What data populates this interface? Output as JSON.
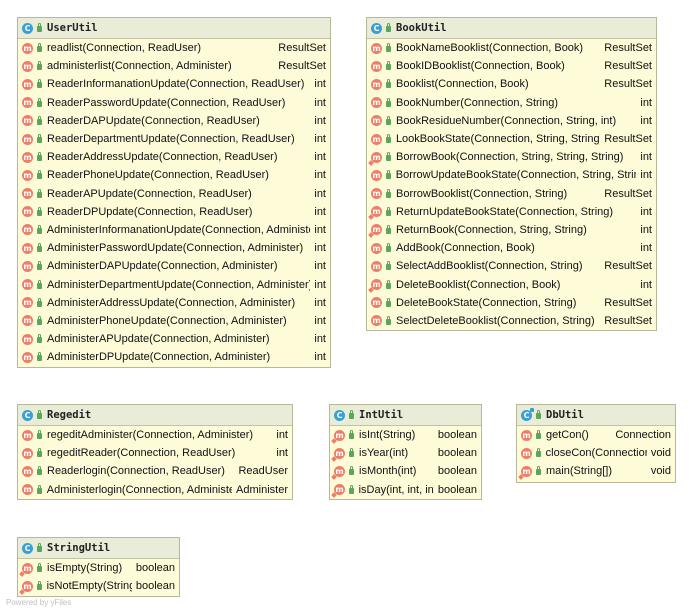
{
  "classes": [
    {
      "id": "userutil",
      "title": "UserUtil",
      "static_icon": false,
      "methods": [
        {
          "sig": "readlist(Connection, ReadUser)",
          "ret": "ResultSet",
          "static": false
        },
        {
          "sig": "administerlist(Connection, Administer)",
          "ret": "ResultSet",
          "static": false
        },
        {
          "sig": "ReaderInformanationUpdate(Connection, ReadUser)",
          "ret": "int",
          "static": false
        },
        {
          "sig": "ReaderPasswordUpdate(Connection, ReadUser)",
          "ret": "int",
          "static": false
        },
        {
          "sig": "ReaderDAPUpdate(Connection, ReadUser)",
          "ret": "int",
          "static": false
        },
        {
          "sig": "ReaderDepartmentUpdate(Connection, ReadUser)",
          "ret": "int",
          "static": false
        },
        {
          "sig": "ReaderAddressUpdate(Connection, ReadUser)",
          "ret": "int",
          "static": false
        },
        {
          "sig": "ReaderPhoneUpdate(Connection, ReadUser)",
          "ret": "int",
          "static": false
        },
        {
          "sig": "ReaderAPUpdate(Connection, ReadUser)",
          "ret": "int",
          "static": false
        },
        {
          "sig": "ReaderDPUpdate(Connection, ReadUser)",
          "ret": "int",
          "static": false
        },
        {
          "sig": "AdministerInformanationUpdate(Connection, Administer)",
          "ret": "int",
          "static": false
        },
        {
          "sig": "AdministerPasswordUpdate(Connection, Administer)",
          "ret": "int",
          "static": false
        },
        {
          "sig": "AdministerDAPUpdate(Connection, Administer)",
          "ret": "int",
          "static": false
        },
        {
          "sig": "AdministerDepartmentUpdate(Connection, Administer)",
          "ret": "int",
          "static": false
        },
        {
          "sig": "AdministerAddressUpdate(Connection, Administer)",
          "ret": "int",
          "static": false
        },
        {
          "sig": "AdministerPhoneUpdate(Connection, Administer)",
          "ret": "int",
          "static": false
        },
        {
          "sig": "AdministerAPUpdate(Connection, Administer)",
          "ret": "int",
          "static": false
        },
        {
          "sig": "AdministerDPUpdate(Connection, Administer)",
          "ret": "int",
          "static": false
        }
      ]
    },
    {
      "id": "bookutil",
      "title": "BookUtil",
      "static_icon": false,
      "methods": [
        {
          "sig": "BookNameBooklist(Connection, Book)",
          "ret": "ResultSet",
          "static": false
        },
        {
          "sig": "BookIDBooklist(Connection, Book)",
          "ret": "ResultSet",
          "static": false
        },
        {
          "sig": "Booklist(Connection, Book)",
          "ret": "ResultSet",
          "static": false
        },
        {
          "sig": "BookNumber(Connection, String)",
          "ret": "int",
          "static": false
        },
        {
          "sig": "BookResidueNumber(Connection, String, int)",
          "ret": "int",
          "static": false
        },
        {
          "sig": "LookBookState(Connection, String, String)",
          "ret": "ResultSet",
          "static": false
        },
        {
          "sig": "BorrowBook(Connection, String, String, String)",
          "ret": "int",
          "static": true
        },
        {
          "sig": "BorrowUpdateBookState(Connection, String, String)",
          "ret": "int",
          "static": false
        },
        {
          "sig": "BorrowBooklist(Connection, String)",
          "ret": "ResultSet",
          "static": false
        },
        {
          "sig": "ReturnUpdateBookState(Connection, String)",
          "ret": "int",
          "static": true
        },
        {
          "sig": "ReturnBook(Connection, String, String)",
          "ret": "int",
          "static": true
        },
        {
          "sig": "AddBook(Connection, Book)",
          "ret": "int",
          "static": false
        },
        {
          "sig": "SelectAddBooklist(Connection, String)",
          "ret": "ResultSet",
          "static": false
        },
        {
          "sig": "DeleteBooklist(Connection, Book)",
          "ret": "int",
          "static": true
        },
        {
          "sig": "DeleteBookState(Connection, String)",
          "ret": "ResultSet",
          "static": false
        },
        {
          "sig": "SelectDeleteBooklist(Connection, String)",
          "ret": "ResultSet",
          "static": false
        }
      ]
    },
    {
      "id": "regedit",
      "title": "Regedit",
      "static_icon": false,
      "methods": [
        {
          "sig": "regeditAdminister(Connection, Administer)",
          "ret": "int",
          "static": false
        },
        {
          "sig": "regeditReader(Connection, ReadUser)",
          "ret": "int",
          "static": false
        },
        {
          "sig": "Readerlogin(Connection, ReadUser)",
          "ret": "ReadUser",
          "static": false
        },
        {
          "sig": "Administerlogin(Connection, Administer)",
          "ret": "Administer",
          "static": false
        }
      ]
    },
    {
      "id": "intutil",
      "title": "IntUtil",
      "static_icon": false,
      "methods": [
        {
          "sig": "isInt(String)",
          "ret": "boolean",
          "static": true
        },
        {
          "sig": "isYear(int)",
          "ret": "boolean",
          "static": true
        },
        {
          "sig": "isMonth(int)",
          "ret": "boolean",
          "static": true
        },
        {
          "sig": "isDay(int, int, int)",
          "ret": "boolean",
          "static": true
        }
      ]
    },
    {
      "id": "dbutil",
      "title": "DbUtil",
      "static_icon": true,
      "methods": [
        {
          "sig": "getCon()",
          "ret": "Connection",
          "static": false
        },
        {
          "sig": "closeCon(Connection)",
          "ret": "void",
          "static": false
        },
        {
          "sig": "main(String[])",
          "ret": "void",
          "static": true
        }
      ]
    },
    {
      "id": "stringutil",
      "title": "StringUtil",
      "static_icon": false,
      "methods": [
        {
          "sig": "isEmpty(String)",
          "ret": "boolean",
          "static": true
        },
        {
          "sig": "isNotEmpty(String)",
          "ret": "boolean",
          "static": true
        }
      ]
    }
  ],
  "footer": "Powered by yFiles",
  "colors": {
    "class_icon": "#3a9fd6",
    "method_icon": "#ef7e68",
    "visibility": "#5ba65a"
  }
}
